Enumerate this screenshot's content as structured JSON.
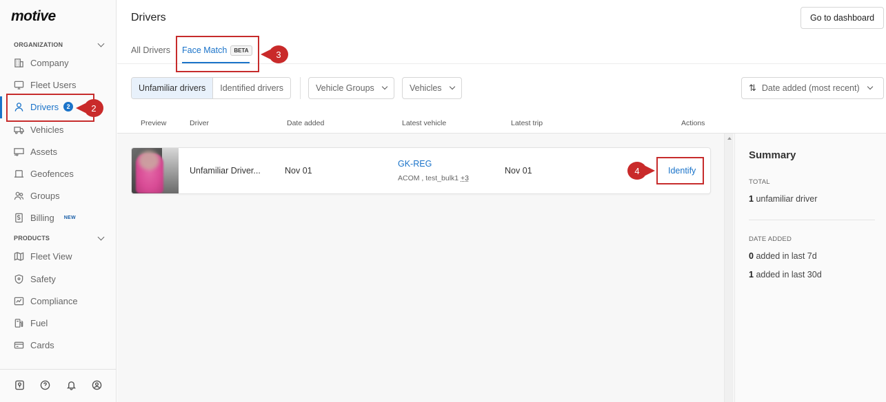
{
  "app": {
    "logo": "motive"
  },
  "sidebar": {
    "organization_label": "ORGANIZATION",
    "products_label": "PRODUCTS",
    "org_items": [
      {
        "label": "Company",
        "icon": "building-icon"
      },
      {
        "label": "Fleet Users",
        "icon": "monitor-icon"
      },
      {
        "label": "Drivers",
        "icon": "user-icon",
        "badge": "2",
        "active": true
      },
      {
        "label": "Vehicles",
        "icon": "truck-icon"
      },
      {
        "label": "Assets",
        "icon": "trailer-icon"
      },
      {
        "label": "Geofences",
        "icon": "geofence-icon"
      },
      {
        "label": "Groups",
        "icon": "groups-icon"
      },
      {
        "label": "Billing",
        "icon": "billing-icon",
        "tag": "NEW"
      }
    ],
    "product_items": [
      {
        "label": "Fleet View",
        "icon": "map-icon"
      },
      {
        "label": "Safety",
        "icon": "shield-icon"
      },
      {
        "label": "Compliance",
        "icon": "compliance-icon"
      },
      {
        "label": "Fuel",
        "icon": "fuel-icon"
      },
      {
        "label": "Cards",
        "icon": "card-icon"
      }
    ],
    "footer_icons": [
      "map-pin-doc-icon",
      "help-icon",
      "bell-icon",
      "account-icon"
    ]
  },
  "header": {
    "title": "Drivers",
    "dashboard_button": "Go to dashboard"
  },
  "tabs": {
    "all_drivers": "All Drivers",
    "face_match": "Face Match",
    "beta": "BETA"
  },
  "filters": {
    "unfamiliar": "Unfamiliar drivers",
    "identified": "Identified drivers",
    "vehicle_groups": "Vehicle Groups",
    "vehicles": "Vehicles",
    "sort": "Date added (most recent)"
  },
  "table": {
    "columns": {
      "preview": "Preview",
      "driver": "Driver",
      "date_added": "Date added",
      "latest_vehicle": "Latest vehicle",
      "latest_trip": "Latest trip",
      "actions": "Actions"
    },
    "rows": [
      {
        "driver": "Unfamiliar Driver...",
        "date_added": "Nov 01",
        "vehicle": "GK-REG",
        "vehicle_groups": "ACOM , test_bulk1",
        "vehicle_more": "+3",
        "latest_trip": "Nov 01",
        "action": "Identify"
      }
    ]
  },
  "summary": {
    "title": "Summary",
    "total_label": "TOTAL",
    "total_count": "1",
    "total_text": "unfamiliar driver",
    "date_added_label": "DATE ADDED",
    "last7_count": "0",
    "last7_text": "added in last 7d",
    "last30_count": "1",
    "last30_text": "added in last 30d"
  },
  "annotations": [
    "2",
    "3",
    "4"
  ],
  "colors": {
    "accent": "#1a73c9",
    "annotation": "#c92a2a"
  }
}
